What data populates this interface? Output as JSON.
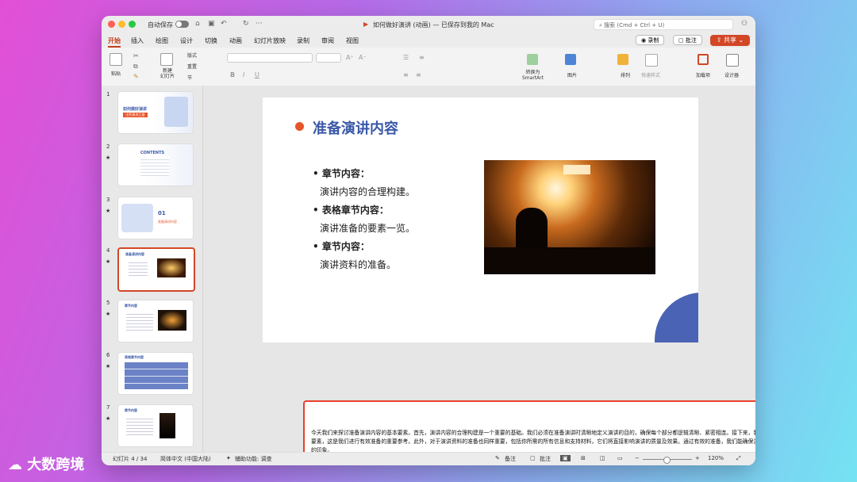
{
  "titlebar": {
    "autosave": "自动保存",
    "document_title": "如何做好演讲 (动画) — 已保存到我的 Mac",
    "search_placeholder": "搜索 (Cmd + Ctrl + U)"
  },
  "menu": [
    "开始",
    "插入",
    "绘图",
    "设计",
    "切换",
    "动画",
    "幻灯片放映",
    "录制",
    "审阅",
    "视图"
  ],
  "menu_buttons": {
    "record": "录制",
    "comment": "批注",
    "share": "共享"
  },
  "ribbon": {
    "paste": "粘贴",
    "new_slide": "新建\n幻灯片",
    "layout": "版式",
    "reset": "重置",
    "section": "节",
    "convert_smartart": "转换为\nSmartArt",
    "picture": "图片",
    "arrange": "排列",
    "quick_styles": "快速样式",
    "addins": "加载项",
    "designer": "设计器"
  },
  "slides": [
    {
      "num": "1",
      "title": "如何做好演讲",
      "subtitle": "·出色演讲之道·",
      "star": false
    },
    {
      "num": "2",
      "title": "CONTENTS",
      "star": true
    },
    {
      "num": "3",
      "title": "01",
      "subtitle": "准备演讲内容",
      "star": true
    },
    {
      "num": "4",
      "title": "准备演讲内容",
      "star": true
    },
    {
      "num": "5",
      "title": "章节内容",
      "star": true
    },
    {
      "num": "6",
      "title": "表格章节内容",
      "star": true
    },
    {
      "num": "7",
      "title": "章节内容",
      "star": true
    }
  ],
  "current_slide": {
    "title": "准备演讲内容",
    "bullets": [
      {
        "heading": "章节内容：",
        "text": "演讲内容的合理构建。"
      },
      {
        "heading": "表格章节内容：",
        "text": "演讲准备的要素一览。"
      },
      {
        "heading": "章节内容：",
        "text": "演讲资料的准备。"
      }
    ]
  },
  "notes": "今天我们来探讨准备演讲内容的基本要素。首先，演讲内容的合理构建是一个重要的基础。我们必须在准备演讲时清晰地定义演讲的目的，确保每个部分都逻辑清晰、紧密相连。接下来，我们将通过一个表格来一览演讲准备的要素，这是我们进行有效准备的重要参考。此外，对于演讲资料的准备也同样重要，包括你所需的所有信息和支持材料，它们将直接影响演讲的质量及效果。通过有效的准备，我们能确保演讲达到预期的目标，让听众留下深刻的印象。",
  "status": {
    "slide_info": "幻灯片 4 / 34",
    "language": "简体中文 (中国大陆)",
    "accessibility": "辅助功能: 调查",
    "notes_btn": "备注",
    "comments_btn": "批注",
    "zoom": "120%"
  },
  "watermark": "大数跨境",
  "colors": {
    "accent": "#d24726",
    "title_blue": "#3a58a8",
    "bullet_dot": "#e8542a",
    "notes_border": "#e8402c"
  }
}
